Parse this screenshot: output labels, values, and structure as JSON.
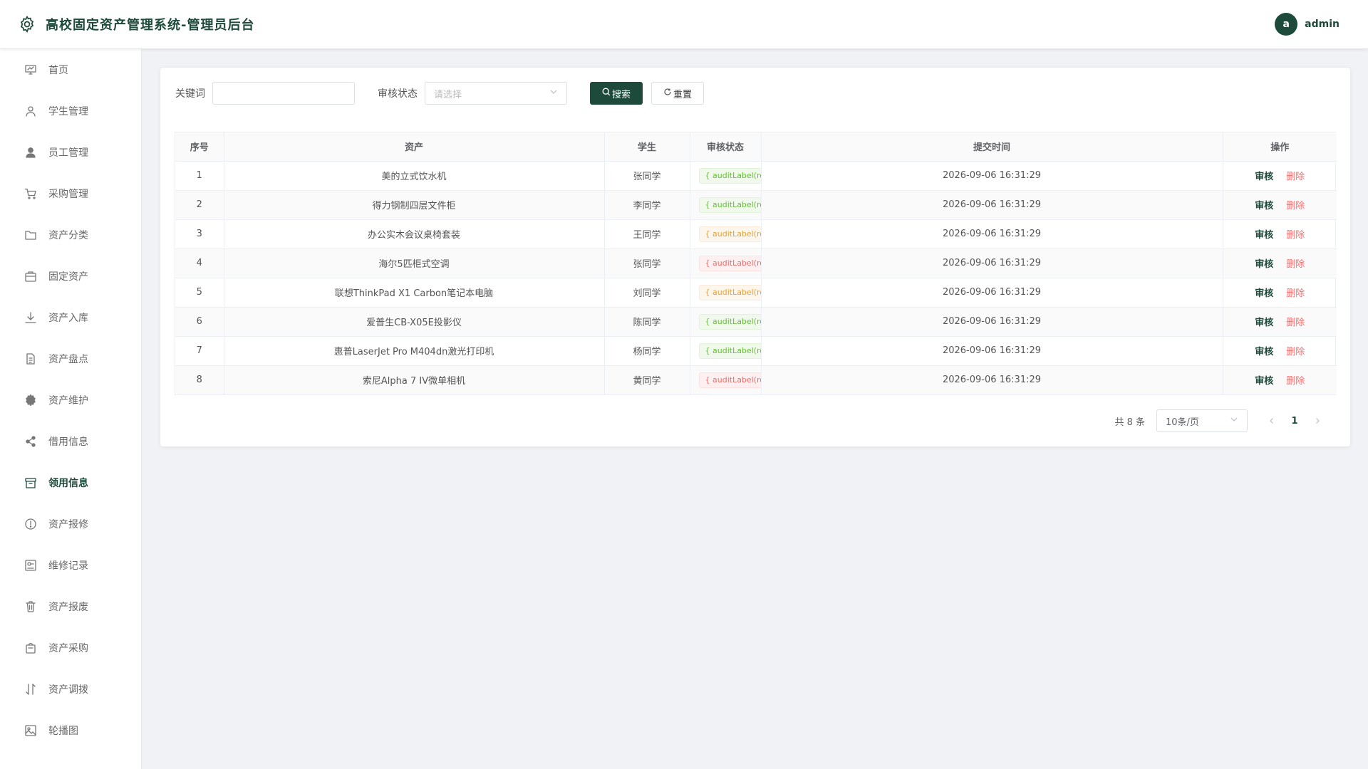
{
  "header": {
    "title": "高校固定资产管理系统-管理员后台",
    "user": {
      "avatar_letter": "a",
      "name": "admin"
    },
    "brand_color": "#1e4a3b"
  },
  "sidebar": {
    "items": [
      {
        "label": "首页",
        "icon": "dashboard-icon",
        "active": false
      },
      {
        "label": "学生管理",
        "icon": "user-icon",
        "active": false
      },
      {
        "label": "员工管理",
        "icon": "user-filled-icon",
        "active": false
      },
      {
        "label": "采购管理",
        "icon": "cart-icon",
        "active": false
      },
      {
        "label": "资产分类",
        "icon": "folder-icon",
        "active": false
      },
      {
        "label": "固定资产",
        "icon": "briefcase-icon",
        "active": false
      },
      {
        "label": "资产入库",
        "icon": "download-icon",
        "active": false
      },
      {
        "label": "资产盘点",
        "icon": "document-icon",
        "active": false
      },
      {
        "label": "资产维护",
        "icon": "gear-icon",
        "active": false
      },
      {
        "label": "借用信息",
        "icon": "share-icon",
        "active": false
      },
      {
        "label": "领用信息",
        "icon": "box-icon",
        "active": true
      },
      {
        "label": "资产报修",
        "icon": "warning-circle-icon",
        "active": false
      },
      {
        "label": "维修记录",
        "icon": "record-icon",
        "active": false
      },
      {
        "label": "资产报废",
        "icon": "trash-icon",
        "active": false
      },
      {
        "label": "资产采购",
        "icon": "bag-icon",
        "active": false
      },
      {
        "label": "资产调拨",
        "icon": "sort-icon",
        "active": false
      },
      {
        "label": "轮播图",
        "icon": "picture-icon",
        "active": false
      }
    ]
  },
  "search": {
    "keyword_label": "关键词",
    "keyword_value": "",
    "status_label": "审核状态",
    "status_placeholder": "请选择",
    "search_button": "搜索",
    "reset_button": "重置"
  },
  "table": {
    "columns": [
      "序号",
      "资产",
      "学生",
      "审核状态",
      "提交时间",
      "操作"
    ],
    "rows": [
      {
        "index": "1",
        "asset": "美的立式饮水机",
        "student": "张同学",
        "status": "{ auditLabel(ro",
        "status_color": "green",
        "time": "2026-09-06 16:31:29"
      },
      {
        "index": "2",
        "asset": "得力钢制四层文件柜",
        "student": "李同学",
        "status": "{ auditLabel(ro",
        "status_color": "green",
        "time": "2026-09-06 16:31:29"
      },
      {
        "index": "3",
        "asset": "办公实木会议桌椅套装",
        "student": "王同学",
        "status": "{ auditLabel(ro",
        "status_color": "orange",
        "time": "2026-09-06 16:31:29"
      },
      {
        "index": "4",
        "asset": "海尔5匹柜式空调",
        "student": "张同学",
        "status": "{ auditLabel(ro",
        "status_color": "red",
        "time": "2026-09-06 16:31:29"
      },
      {
        "index": "5",
        "asset": "联想ThinkPad X1 Carbon笔记本电脑",
        "student": "刘同学",
        "status": "{ auditLabel(ro",
        "status_color": "orange",
        "time": "2026-09-06 16:31:29"
      },
      {
        "index": "6",
        "asset": "爱普生CB-X05E投影仪",
        "student": "陈同学",
        "status": "{ auditLabel(ro",
        "status_color": "green",
        "time": "2026-09-06 16:31:29"
      },
      {
        "index": "7",
        "asset": "惠普LaserJet Pro M404dn激光打印机",
        "student": "杨同学",
        "status": "{ auditLabel(ro",
        "status_color": "green",
        "time": "2026-09-06 16:31:29"
      },
      {
        "index": "8",
        "asset": "索尼Alpha 7 IV微单相机",
        "student": "黄同学",
        "status": "{ auditLabel(ro",
        "status_color": "red",
        "time": "2026-09-06 16:31:29"
      }
    ],
    "action_audit": "审核",
    "action_delete": "删除"
  },
  "pagination": {
    "total_text": "共 8 条",
    "page_size": "10条/页",
    "current_page": "1"
  }
}
